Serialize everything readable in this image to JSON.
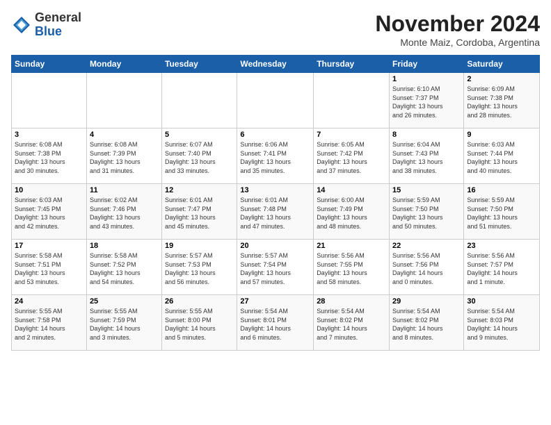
{
  "header": {
    "logo_general": "General",
    "logo_blue": "Blue",
    "month_title": "November 2024",
    "location": "Monte Maiz, Cordoba, Argentina"
  },
  "weekdays": [
    "Sunday",
    "Monday",
    "Tuesday",
    "Wednesday",
    "Thursday",
    "Friday",
    "Saturday"
  ],
  "weeks": [
    [
      {
        "day": "",
        "info": ""
      },
      {
        "day": "",
        "info": ""
      },
      {
        "day": "",
        "info": ""
      },
      {
        "day": "",
        "info": ""
      },
      {
        "day": "",
        "info": ""
      },
      {
        "day": "1",
        "info": "Sunrise: 6:10 AM\nSunset: 7:37 PM\nDaylight: 13 hours\nand 26 minutes."
      },
      {
        "day": "2",
        "info": "Sunrise: 6:09 AM\nSunset: 7:38 PM\nDaylight: 13 hours\nand 28 minutes."
      }
    ],
    [
      {
        "day": "3",
        "info": "Sunrise: 6:08 AM\nSunset: 7:38 PM\nDaylight: 13 hours\nand 30 minutes."
      },
      {
        "day": "4",
        "info": "Sunrise: 6:08 AM\nSunset: 7:39 PM\nDaylight: 13 hours\nand 31 minutes."
      },
      {
        "day": "5",
        "info": "Sunrise: 6:07 AM\nSunset: 7:40 PM\nDaylight: 13 hours\nand 33 minutes."
      },
      {
        "day": "6",
        "info": "Sunrise: 6:06 AM\nSunset: 7:41 PM\nDaylight: 13 hours\nand 35 minutes."
      },
      {
        "day": "7",
        "info": "Sunrise: 6:05 AM\nSunset: 7:42 PM\nDaylight: 13 hours\nand 37 minutes."
      },
      {
        "day": "8",
        "info": "Sunrise: 6:04 AM\nSunset: 7:43 PM\nDaylight: 13 hours\nand 38 minutes."
      },
      {
        "day": "9",
        "info": "Sunrise: 6:03 AM\nSunset: 7:44 PM\nDaylight: 13 hours\nand 40 minutes."
      }
    ],
    [
      {
        "day": "10",
        "info": "Sunrise: 6:03 AM\nSunset: 7:45 PM\nDaylight: 13 hours\nand 42 minutes."
      },
      {
        "day": "11",
        "info": "Sunrise: 6:02 AM\nSunset: 7:46 PM\nDaylight: 13 hours\nand 43 minutes."
      },
      {
        "day": "12",
        "info": "Sunrise: 6:01 AM\nSunset: 7:47 PM\nDaylight: 13 hours\nand 45 minutes."
      },
      {
        "day": "13",
        "info": "Sunrise: 6:01 AM\nSunset: 7:48 PM\nDaylight: 13 hours\nand 47 minutes."
      },
      {
        "day": "14",
        "info": "Sunrise: 6:00 AM\nSunset: 7:49 PM\nDaylight: 13 hours\nand 48 minutes."
      },
      {
        "day": "15",
        "info": "Sunrise: 5:59 AM\nSunset: 7:50 PM\nDaylight: 13 hours\nand 50 minutes."
      },
      {
        "day": "16",
        "info": "Sunrise: 5:59 AM\nSunset: 7:50 PM\nDaylight: 13 hours\nand 51 minutes."
      }
    ],
    [
      {
        "day": "17",
        "info": "Sunrise: 5:58 AM\nSunset: 7:51 PM\nDaylight: 13 hours\nand 53 minutes."
      },
      {
        "day": "18",
        "info": "Sunrise: 5:58 AM\nSunset: 7:52 PM\nDaylight: 13 hours\nand 54 minutes."
      },
      {
        "day": "19",
        "info": "Sunrise: 5:57 AM\nSunset: 7:53 PM\nDaylight: 13 hours\nand 56 minutes."
      },
      {
        "day": "20",
        "info": "Sunrise: 5:57 AM\nSunset: 7:54 PM\nDaylight: 13 hours\nand 57 minutes."
      },
      {
        "day": "21",
        "info": "Sunrise: 5:56 AM\nSunset: 7:55 PM\nDaylight: 13 hours\nand 58 minutes."
      },
      {
        "day": "22",
        "info": "Sunrise: 5:56 AM\nSunset: 7:56 PM\nDaylight: 14 hours\nand 0 minutes."
      },
      {
        "day": "23",
        "info": "Sunrise: 5:56 AM\nSunset: 7:57 PM\nDaylight: 14 hours\nand 1 minute."
      }
    ],
    [
      {
        "day": "24",
        "info": "Sunrise: 5:55 AM\nSunset: 7:58 PM\nDaylight: 14 hours\nand 2 minutes."
      },
      {
        "day": "25",
        "info": "Sunrise: 5:55 AM\nSunset: 7:59 PM\nDaylight: 14 hours\nand 3 minutes."
      },
      {
        "day": "26",
        "info": "Sunrise: 5:55 AM\nSunset: 8:00 PM\nDaylight: 14 hours\nand 5 minutes."
      },
      {
        "day": "27",
        "info": "Sunrise: 5:54 AM\nSunset: 8:01 PM\nDaylight: 14 hours\nand 6 minutes."
      },
      {
        "day": "28",
        "info": "Sunrise: 5:54 AM\nSunset: 8:02 PM\nDaylight: 14 hours\nand 7 minutes."
      },
      {
        "day": "29",
        "info": "Sunrise: 5:54 AM\nSunset: 8:02 PM\nDaylight: 14 hours\nand 8 minutes."
      },
      {
        "day": "30",
        "info": "Sunrise: 5:54 AM\nSunset: 8:03 PM\nDaylight: 14 hours\nand 9 minutes."
      }
    ]
  ]
}
